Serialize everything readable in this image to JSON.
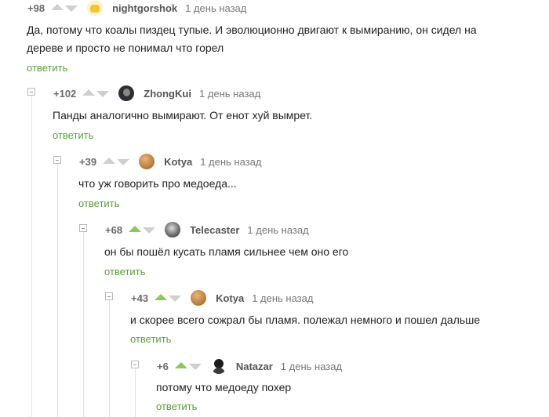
{
  "reply_label": "ответить",
  "comments": [
    {
      "rating": "+98",
      "author": "nightgorshok",
      "time": "1 день назад",
      "avatar": "nightgorshok-avatar",
      "voted_up": false,
      "lines": [
        "Да, потому что коалы пиздец тупые. И эволюционно двигают к вымиранию, он сидел на",
        "дереве и просто не понимал что горел"
      ]
    },
    {
      "rating": "+102",
      "author": "ZhongKui",
      "time": "1 день назад",
      "avatar": "zhongkui-avatar",
      "voted_up": false,
      "lines": [
        "Панды аналогично вымирают. От енот хуй вымрет."
      ]
    },
    {
      "rating": "+39",
      "author": "Kotya",
      "time": "1 день назад",
      "avatar": "kotya-avatar",
      "voted_up": false,
      "lines": [
        "что уж говорить про медоеда..."
      ]
    },
    {
      "rating": "+68",
      "author": "Telecaster",
      "time": "1 день назад",
      "avatar": "telecaster-avatar",
      "voted_up": true,
      "lines": [
        "он бы пошёл кусать пламя сильнее чем оно его"
      ]
    },
    {
      "rating": "+43",
      "author": "Kotya",
      "time": "1 день назад",
      "avatar": "kotya-avatar",
      "voted_up": true,
      "lines": [
        "и скорее всего сожрал бы пламя. полежал немного и пошел дальше"
      ]
    },
    {
      "rating": "+6",
      "author": "Natazar",
      "time": "1 день назад",
      "avatar": "natazar-avatar",
      "voted_up": true,
      "lines": [
        "потому что медоеду похер"
      ]
    }
  ],
  "colors": {
    "accent": "#5a9e3a",
    "upvote_active": "#8ac858",
    "arrow_inactive": "#cfcfcf"
  }
}
